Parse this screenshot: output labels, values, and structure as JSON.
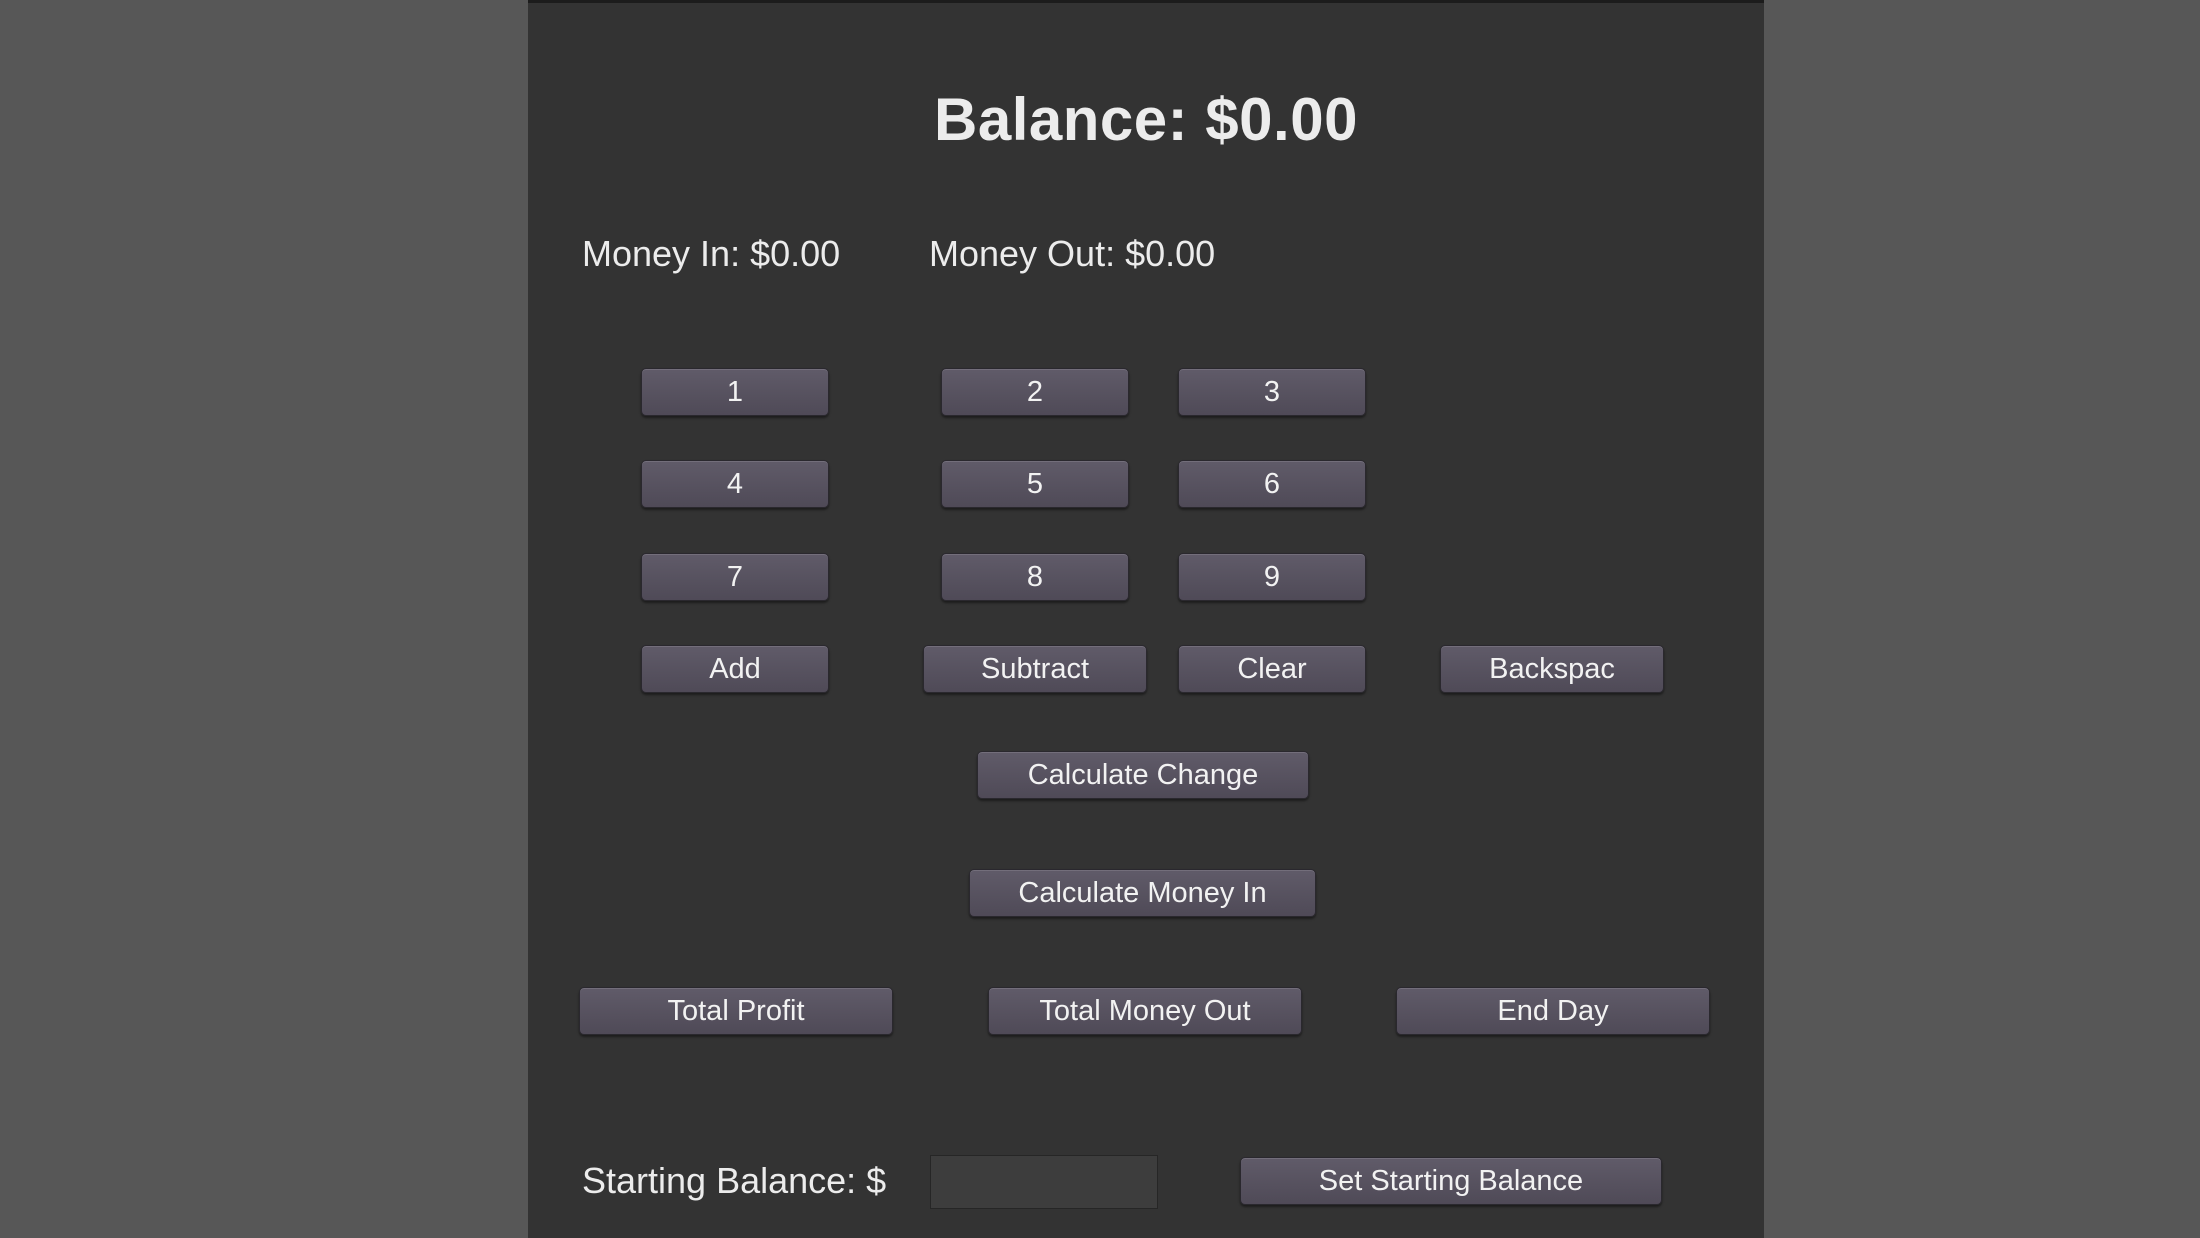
{
  "balance": {
    "label": "Balance: $0.00"
  },
  "money_in": {
    "label": "Money In: $0.00"
  },
  "money_out": {
    "label": "Money Out: $0.00"
  },
  "keypad": {
    "digits": [
      "1",
      "2",
      "3",
      "4",
      "5",
      "6",
      "7",
      "8",
      "9"
    ],
    "add": "Add",
    "subtract": "Subtract",
    "clear": "Clear",
    "backspace": "Backspac"
  },
  "actions": {
    "calculate_change": "Calculate Change",
    "calculate_money_in": "Calculate Money In",
    "total_profit": "Total Profit",
    "total_money_out": "Total Money Out",
    "end_day": "End Day"
  },
  "starting_balance": {
    "label": "Starting Balance: $",
    "value": "",
    "button": "Set Starting Balance"
  },
  "colors": {
    "background": "#575757",
    "window": "#333333",
    "button": "#58535f",
    "text": "#ececec"
  }
}
